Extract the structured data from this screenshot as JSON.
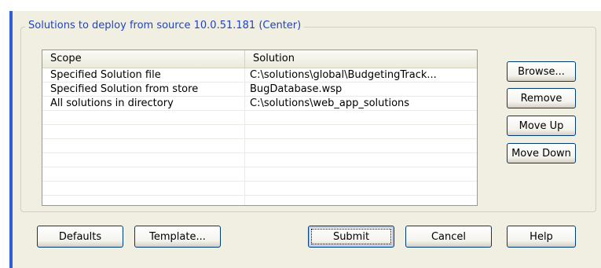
{
  "group": {
    "title": "Solutions to deploy from source 10.0.51.181 (Center)"
  },
  "table": {
    "columns": [
      "Scope",
      "Solution"
    ],
    "rows": [
      {
        "scope": "Specified Solution file",
        "solution": "C:\\solutions\\global\\BudgetingTrack..."
      },
      {
        "scope": "Specified Solution from store",
        "solution": "BugDatabase.wsp"
      },
      {
        "scope": "All solutions in directory",
        "solution": "C:\\solutions\\web_app_solutions"
      },
      {
        "scope": "",
        "solution": ""
      },
      {
        "scope": "",
        "solution": ""
      },
      {
        "scope": "",
        "solution": ""
      },
      {
        "scope": "",
        "solution": ""
      },
      {
        "scope": "",
        "solution": ""
      },
      {
        "scope": "",
        "solution": ""
      },
      {
        "scope": "",
        "solution": ""
      }
    ]
  },
  "side_buttons": {
    "browse": "Browse...",
    "remove": "Remove",
    "move_up": "Move Up",
    "move_down": "Move Down"
  },
  "bottom_buttons": {
    "defaults": "Defaults",
    "template": "Template...",
    "submit": "Submit",
    "cancel": "Cancel",
    "help": "Help"
  },
  "colors": {
    "accent": "#2d5fd8",
    "group_title": "#1f43c8",
    "dialog_bg": "#f0efe2",
    "button_border": "#003c74"
  }
}
